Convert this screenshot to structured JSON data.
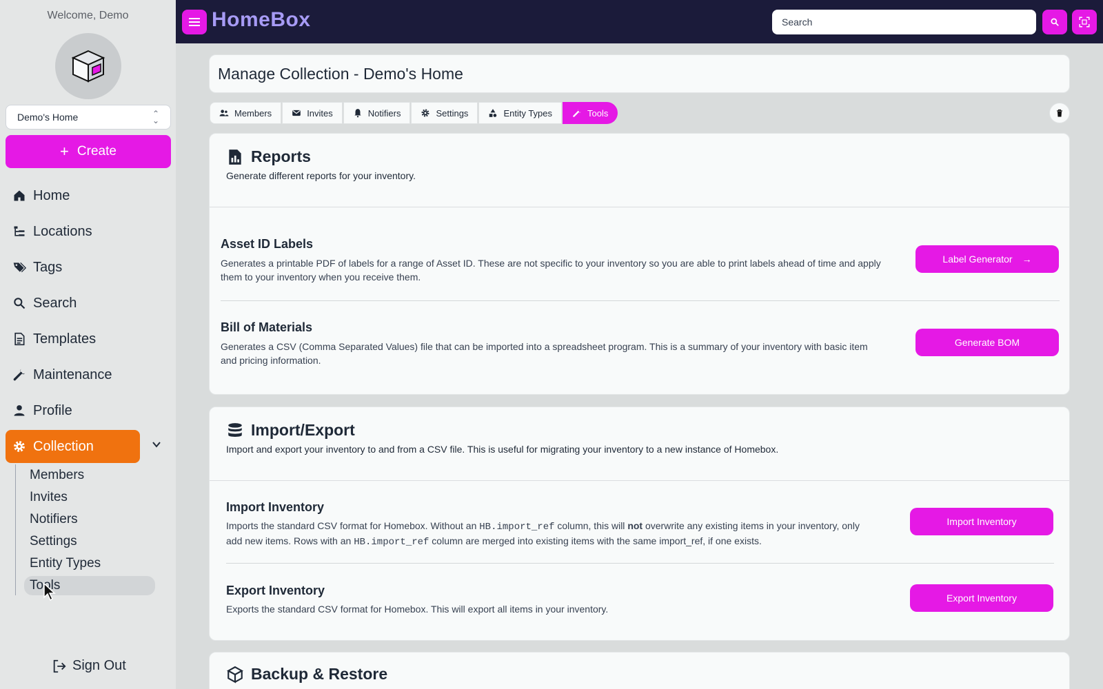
{
  "sidebar": {
    "welcome": "Welcome, Demo",
    "home_select": "Demo's Home",
    "create_label": "Create",
    "nav": [
      {
        "label": "Home",
        "icon": "home-icon"
      },
      {
        "label": "Locations",
        "icon": "locations-icon"
      },
      {
        "label": "Tags",
        "icon": "tags-icon"
      },
      {
        "label": "Search",
        "icon": "search-icon"
      },
      {
        "label": "Templates",
        "icon": "templates-icon"
      },
      {
        "label": "Maintenance",
        "icon": "wrench-icon"
      },
      {
        "label": "Profile",
        "icon": "user-icon"
      },
      {
        "label": "Collection",
        "icon": "gear-icon"
      }
    ],
    "sub_nav": [
      "Members",
      "Invites",
      "Notifiers",
      "Settings",
      "Entity Types",
      "Tools"
    ],
    "sign_out": "Sign Out"
  },
  "topbar": {
    "logo": "HomeBox",
    "search_placeholder": "Search"
  },
  "page": {
    "title": "Manage Collection - Demo's Home",
    "tabs": [
      "Members",
      "Invites",
      "Notifiers",
      "Settings",
      "Entity Types",
      "Tools"
    ],
    "active_tab": "Tools"
  },
  "reports": {
    "title": "Reports",
    "subtitle": "Generate different reports for your inventory.",
    "asset_labels": {
      "title": "Asset ID Labels",
      "desc": "Generates a printable PDF of labels for a range of Asset ID. These are not specific to your inventory so you are able to print labels ahead of time and apply them to your inventory when you receive them.",
      "button": "Label Generator"
    },
    "bom": {
      "title": "Bill of Materials",
      "desc": "Generates a CSV (Comma Separated Values) file that can be imported into a spreadsheet program. This is a summary of your inventory with basic item and pricing information.",
      "button": "Generate BOM"
    }
  },
  "import_export": {
    "title": "Import/Export",
    "subtitle": "Import and export your inventory to and from a CSV file. This is useful for migrating your inventory to a new instance of Homebox.",
    "import": {
      "title": "Import Inventory",
      "desc_1": "Imports the standard CSV format for Homebox. Without an ",
      "code": "HB.import_ref",
      "desc_2": " column, this will ",
      "bold": "not",
      "desc_3": " overwrite any existing items in your inventory, only add new items. Rows with an ",
      "desc_4": " column are merged into existing items with the same import_ref, if one exists.",
      "button": "Import Inventory"
    },
    "export": {
      "title": "Export Inventory",
      "desc": "Exports the standard CSV format for Homebox. This will export all items in your inventory.",
      "button": "Export Inventory"
    }
  },
  "backup": {
    "title": "Backup & Restore"
  },
  "colors": {
    "accent": "#e519e5",
    "active_nav": "#f0720f",
    "topbar": "#1b1b3a",
    "logo": "#a79bf5"
  }
}
